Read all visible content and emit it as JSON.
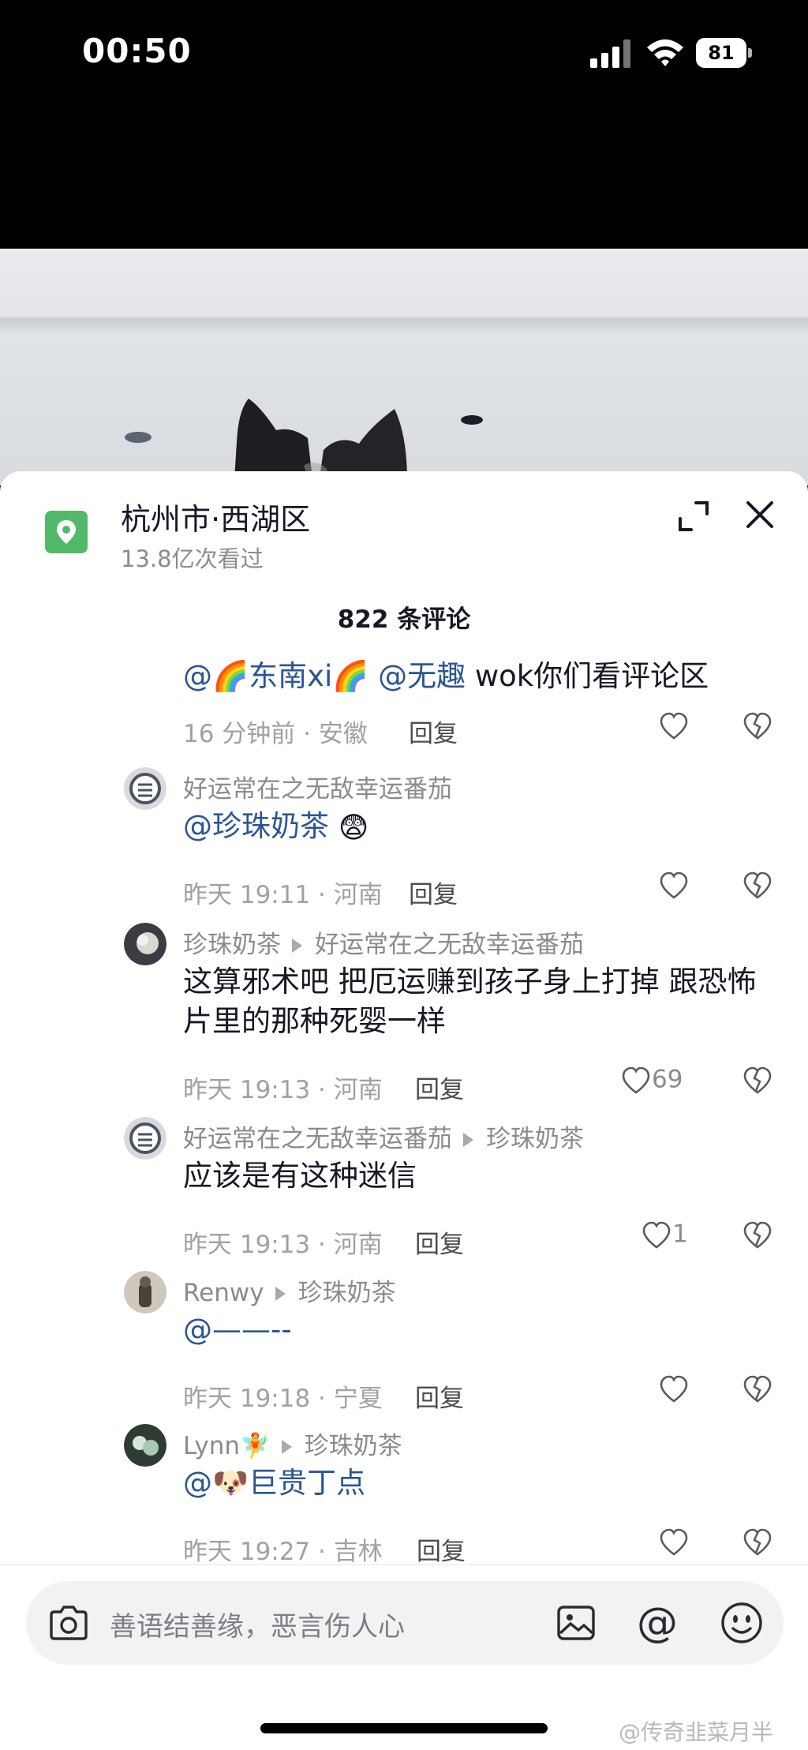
{
  "status_bar": {
    "time": "00:50",
    "battery": "81"
  },
  "location": {
    "title": "杭州市·西湖区",
    "views": "13.8亿次看过"
  },
  "comments_count": "822 条评论",
  "comments": [
    {
      "mentions": [
        "@🌈东南xi🌈",
        "@无趣"
      ],
      "text": " wok你们看评论区",
      "meta": "16 分钟前 · 安徽",
      "reply": "回复"
    },
    {
      "author": "好运常在之无敌幸运番茄",
      "mention": "@珍珠奶茶",
      "emoji": "😨",
      "meta": "昨天 19:11 · 河南",
      "reply": "回复"
    },
    {
      "author": "珍珠奶茶",
      "reply_to": "好运常在之无敌幸运番茄",
      "text": "这算邪术吧 把厄运赚到孩子身上打掉 跟恐怖片里的那种死婴一样",
      "meta": "昨天 19:13 · 河南",
      "reply": "回复",
      "likes": "69"
    },
    {
      "author": "好运常在之无敌幸运番茄",
      "reply_to": "珍珠奶茶",
      "text": "应该是有这种迷信",
      "meta": "昨天 19:13 · 河南",
      "reply": "回复",
      "likes": "1"
    },
    {
      "author": "Renwy",
      "reply_to": "珍珠奶茶",
      "mention": "@——--",
      "meta": "昨天 19:18 · 宁夏",
      "reply": "回复"
    },
    {
      "author": "Lynn🧚",
      "reply_to": "珍珠奶茶",
      "mention": "@🐶巨贵丁点",
      "meta": "昨天 19:27 · 吉林",
      "reply": "回复"
    }
  ],
  "input": {
    "placeholder": "善语结善缘，恶言伤人心"
  },
  "watermark": "@传奇韭菜月半",
  "colors": {
    "mention": "#2b5693",
    "location_icon": "#52b96a",
    "secondary_text": "#8a8b91"
  }
}
